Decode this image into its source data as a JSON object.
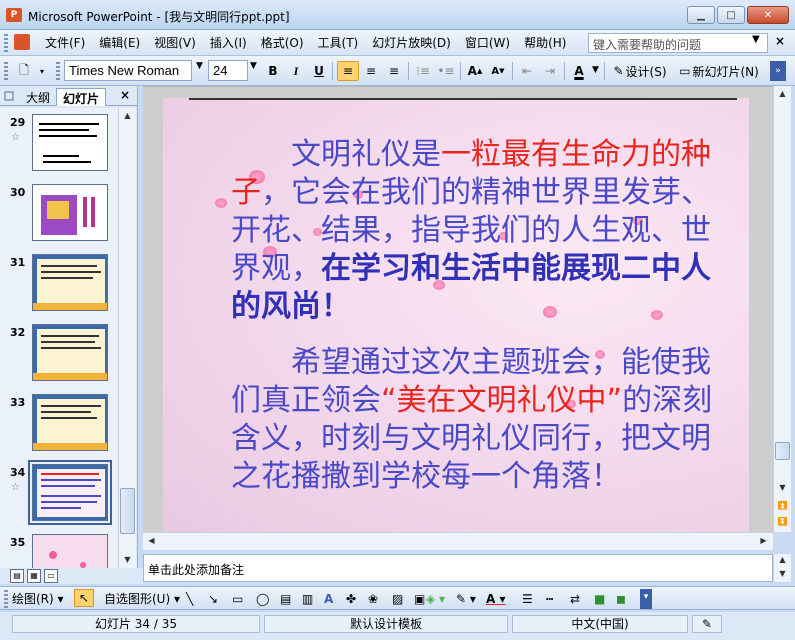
{
  "window": {
    "title": "Microsoft PowerPoint - [我与文明同行ppt.ppt]",
    "app_icon_label": "P"
  },
  "menu": {
    "items": [
      "文件(F)",
      "编辑(E)",
      "视图(V)",
      "插入(I)",
      "格式(O)",
      "工具(T)",
      "幻灯片放映(D)",
      "窗口(W)",
      "帮助(H)"
    ],
    "help_placeholder": "键入需要帮助的问题"
  },
  "toolbar": {
    "font_name": "Times New Roman",
    "font_size": "24",
    "bold": "B",
    "italic": "I",
    "underline": "U",
    "design_label": "设计(S)",
    "new_slide_label": "新幻灯片(N)",
    "font_color_label": "A",
    "align_left_active": true
  },
  "pane": {
    "tab_outline": "大纲",
    "tab_slides": "幻灯片",
    "close": "×",
    "thumbnails": [
      {
        "number": "29",
        "has_star": true
      },
      {
        "number": "30",
        "has_star": false
      },
      {
        "number": "31",
        "has_star": false
      },
      {
        "number": "32",
        "has_star": false
      },
      {
        "number": "33",
        "has_star": false
      },
      {
        "number": "34",
        "has_star": true,
        "selected": true
      },
      {
        "number": "35",
        "has_star": false
      }
    ]
  },
  "slide": {
    "para1_parts": [
      {
        "text": "文明礼仪是",
        "style": "normal"
      },
      {
        "text": "一粒最有生命力的种子",
        "style": "red"
      },
      {
        "text": "，它会在我们的精神世界里发芽、开花、结果，指导我们的人生观、世界观，",
        "style": "normal"
      },
      {
        "text": "在学习和生活中能展现二中人的风尚！",
        "style": "bold"
      }
    ],
    "para2_parts": [
      {
        "text": "希望通过这次主题班会，能使我们真正领会",
        "style": "normal"
      },
      {
        "text": "“美在文明礼仪中”",
        "style": "red"
      },
      {
        "text": "的深刻含义，时刻与文明礼仪同行，把文明之花播撒到学校每一个角落！",
        "style": "normal"
      }
    ]
  },
  "notes": {
    "placeholder": "单击此处添加备注"
  },
  "drawbar": {
    "draw_label": "绘图(R)",
    "autoshapes_label": "自选图形(U)"
  },
  "status": {
    "slide_position": "幻灯片 34 / 35",
    "template": "默认设计模板",
    "language": "中文(中国)"
  },
  "colors": {
    "slide_text": "#4a4ac7",
    "highlight_red": "#e8261d",
    "chrome_blue": "#d2e1f3"
  }
}
